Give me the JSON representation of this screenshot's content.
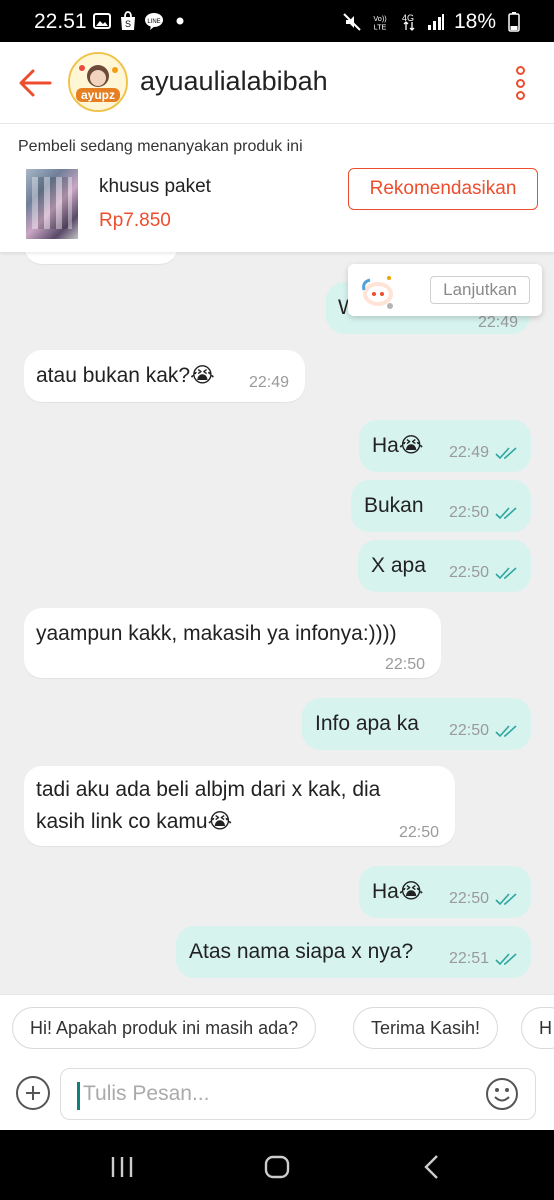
{
  "status_bar": {
    "time": "22.51",
    "network": "4G",
    "lte_label": "VoLTE",
    "battery": "18%"
  },
  "header": {
    "title": "ayuaulialabibah",
    "avatar_text": "ayupz"
  },
  "product": {
    "note": "Pembeli sedang menanyakan produk ini",
    "name": "khusus paket",
    "price": "Rp7.850",
    "button_label": "Rekomendasikan"
  },
  "float_card": {
    "button_label": "Lanjutkan",
    "partial_text": "W",
    "partial_time": "22:49"
  },
  "messages": [
    {
      "side": "in",
      "text": "atau bukan kak?😭",
      "time": "22:49"
    },
    {
      "side": "out",
      "text": "Ha😭",
      "time": "22:49"
    },
    {
      "side": "out",
      "text": "Bukan",
      "time": "22:50"
    },
    {
      "side": "out",
      "text": "X apa",
      "time": "22:50"
    },
    {
      "side": "in",
      "text": "yaampun kakk, makasih ya infonya:))))",
      "time": "22:50"
    },
    {
      "side": "out",
      "text": "Info apa ka",
      "time": "22:50"
    },
    {
      "side": "in",
      "text_line1": "tadi aku ada beli albjm dari x kak, dia",
      "text_line2": "kasih link co kamu😭",
      "time": "22:50"
    },
    {
      "side": "out",
      "text": "Ha😭",
      "time": "22:50"
    },
    {
      "side": "out",
      "text": "Atas nama siapa x nya?",
      "time": "22:51"
    }
  ],
  "quick_replies": [
    "Hi! Apakah produk ini masih ada?",
    "Terima Kasih!",
    "H"
  ],
  "input": {
    "placeholder": "Tulis Pesan..."
  },
  "colors": {
    "accent": "#ee4d2d",
    "outgoing_bubble": "#d6f3ee",
    "read_ticks": "#2fa7a0"
  }
}
